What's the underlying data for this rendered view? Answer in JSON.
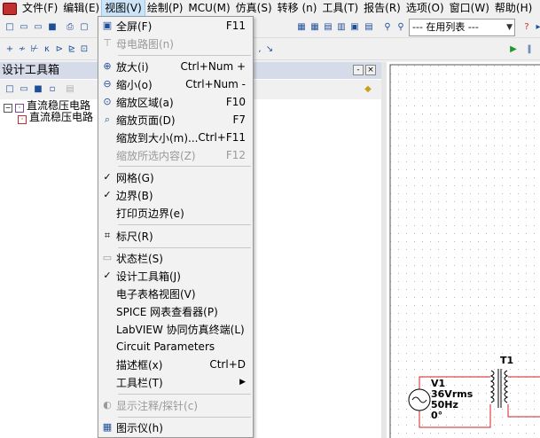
{
  "menubar": {
    "items": [
      "文件(F)",
      "编辑(E)",
      "视图(V)",
      "绘制(P)",
      "MCU(M)",
      "仿真(S)",
      "转移 (n)",
      "工具(T)",
      "报告(R)",
      "选项(O)",
      "窗口(W)",
      "帮助(H)"
    ]
  },
  "toolbar": {
    "in_use_list": "--- 在用列表 ---"
  },
  "design_toolbox": {
    "title": "设计工具箱",
    "tree": {
      "root": "直流稳压电路",
      "child": "直流稳压电路"
    }
  },
  "view_menu": {
    "items": [
      {
        "label": "全屏(F)",
        "shortcut": "F11",
        "icon": "fullscreen-icon",
        "enabled": true
      },
      {
        "label": "母电路图(n)",
        "shortcut": "",
        "icon": "parent-sheet-icon",
        "enabled": false
      },
      {
        "label": "放大(i)",
        "shortcut": "Ctrl+Num +",
        "icon": "zoom-in-icon",
        "enabled": true
      },
      {
        "label": "缩小(o)",
        "shortcut": "Ctrl+Num -",
        "icon": "zoom-out-icon",
        "enabled": true
      },
      {
        "label": "缩放区域(a)",
        "shortcut": "F10",
        "icon": "zoom-area-icon",
        "enabled": true
      },
      {
        "label": "缩放页面(D)",
        "shortcut": "F7",
        "icon": "zoom-page-icon",
        "enabled": true
      },
      {
        "label": "缩放到大小(m)...",
        "shortcut": "Ctrl+F11",
        "icon": "",
        "enabled": true
      },
      {
        "label": "缩放所选内容(Z)",
        "shortcut": "F12",
        "icon": "",
        "enabled": false
      },
      {
        "label": "网格(G)",
        "shortcut": "",
        "icon": "check-icon",
        "enabled": true
      },
      {
        "label": "边界(B)",
        "shortcut": "",
        "icon": "check-icon",
        "enabled": true
      },
      {
        "label": "打印页边界(e)",
        "shortcut": "",
        "icon": "",
        "enabled": true
      },
      {
        "label": "标尺(R)",
        "shortcut": "",
        "icon": "ruler-icon",
        "enabled": true
      },
      {
        "label": "状态栏(S)",
        "shortcut": "",
        "icon": "status-bar-icon",
        "enabled": true
      },
      {
        "label": "设计工具箱(J)",
        "shortcut": "",
        "icon": "check-icon",
        "enabled": true
      },
      {
        "label": "电子表格视图(V)",
        "shortcut": "",
        "icon": "",
        "enabled": true
      },
      {
        "label": "SPICE 网表查看器(P)",
        "shortcut": "",
        "icon": "",
        "enabled": true
      },
      {
        "label": "LabVIEW 协同仿真终端(L)",
        "shortcut": "",
        "icon": "",
        "enabled": true
      },
      {
        "label": "Circuit Parameters",
        "shortcut": "",
        "icon": "",
        "enabled": true
      },
      {
        "label": "描述框(x)",
        "shortcut": "Ctrl+D",
        "icon": "",
        "enabled": true
      },
      {
        "label": "工具栏(T)",
        "shortcut": "▶",
        "icon": "",
        "enabled": true
      },
      {
        "label": "显示注释/探针(c)",
        "shortcut": "",
        "icon": "comment-probe-icon",
        "enabled": false
      },
      {
        "label": "图示仪(h)",
        "shortcut": "",
        "icon": "grapher-icon",
        "enabled": true
      }
    ]
  },
  "circuit": {
    "transformer_label": "T1",
    "source_name": "V1",
    "source_voltage": "36Vrms",
    "source_freq": "50Hz",
    "source_phase": "0°"
  }
}
